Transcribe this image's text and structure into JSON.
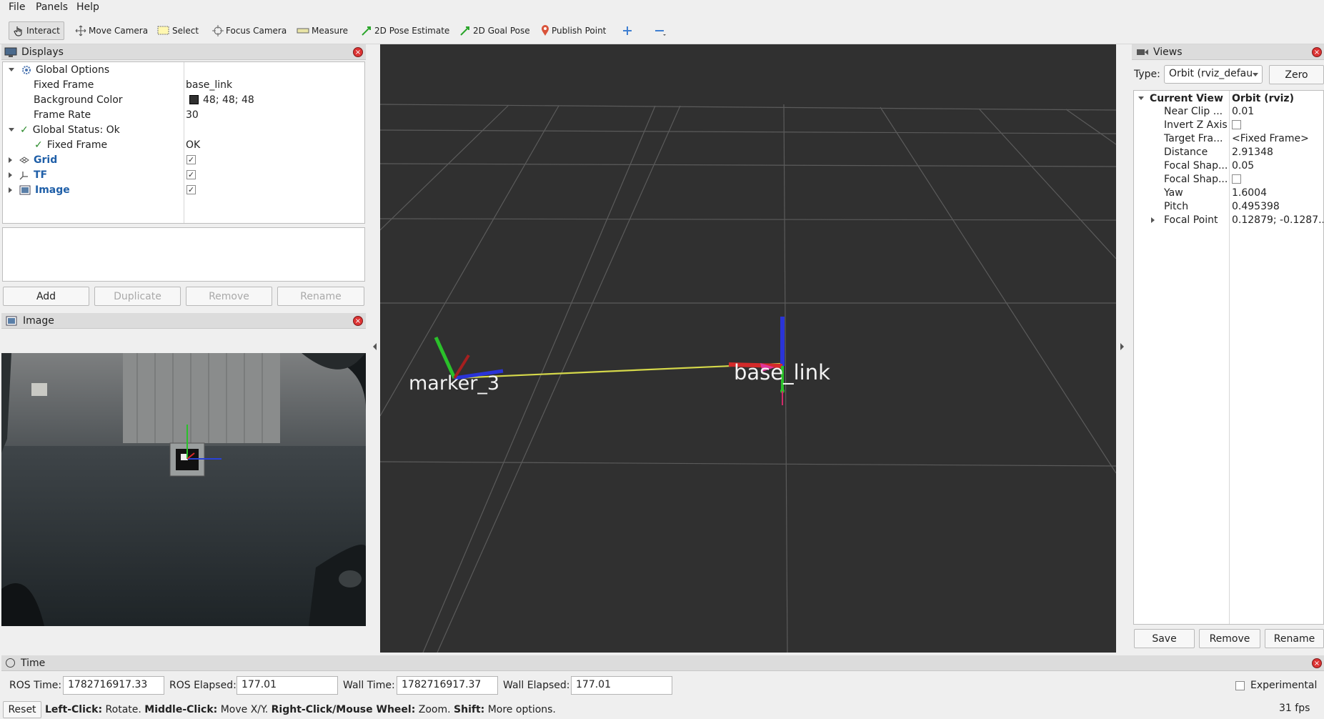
{
  "menu": [
    "File",
    "Panels",
    "Help"
  ],
  "toolbar": {
    "interact": "Interact",
    "move_camera": "Move Camera",
    "select": "Select",
    "focus_camera": "Focus Camera",
    "measure": "Measure",
    "pose_estimate": "2D Pose Estimate",
    "goal_pose": "2D Goal Pose",
    "publish_point": "Publish Point"
  },
  "displays": {
    "title": "Displays",
    "global_options": "Global Options",
    "fixed_frame_label": "Fixed Frame",
    "fixed_frame_value": "base_link",
    "bg_color_label": "Background Color",
    "bg_color_value": "48; 48; 48",
    "bg_color_hex": "#303030",
    "frame_rate_label": "Frame Rate",
    "frame_rate_value": "30",
    "global_status": "Global Status: Ok",
    "status_fixed_frame": "Fixed Frame",
    "status_fixed_frame_value": "OK",
    "items": [
      "Grid",
      "TF",
      "Image"
    ],
    "buttons": {
      "add": "Add",
      "duplicate": "Duplicate",
      "remove": "Remove",
      "rename": "Rename"
    }
  },
  "image_panel": {
    "title": "Image"
  },
  "viewport": {
    "labels": {
      "marker": "marker_3",
      "base": "base_link"
    },
    "bg_color": "#303030"
  },
  "views": {
    "title": "Views",
    "type_label": "Type:",
    "type_value": "Orbit (rviz_defau",
    "zero": "Zero",
    "current_view": "Current View",
    "current_view_value": "Orbit (rviz)",
    "props": [
      {
        "k": "Near Clip ...",
        "v": "0.01"
      },
      {
        "k": "Invert Z Axis",
        "v": ""
      },
      {
        "k": "Target Fra...",
        "v": "<Fixed Frame>"
      },
      {
        "k": "Distance",
        "v": "2.91348"
      },
      {
        "k": "Focal Shap...",
        "v": "0.05"
      },
      {
        "k": "Focal Shap...",
        "v": ""
      },
      {
        "k": "Yaw",
        "v": "1.6004"
      },
      {
        "k": "Pitch",
        "v": "0.495398"
      },
      {
        "k": "Focal Point",
        "v": "0.12879; -0.1287..."
      }
    ],
    "buttons": {
      "save": "Save",
      "remove": "Remove",
      "rename": "Rename"
    }
  },
  "time": {
    "title": "Time",
    "ros_time_label": "ROS Time:",
    "ros_time": "1782716917.33",
    "ros_elapsed_label": "ROS Elapsed:",
    "ros_elapsed": "177.01",
    "wall_time_label": "Wall Time:",
    "wall_time": "1782716917.37",
    "wall_elapsed_label": "Wall Elapsed:",
    "wall_elapsed": "177.01",
    "experimental": "Experimental"
  },
  "status": {
    "reset": "Reset",
    "k1": "Left-Click:",
    "v1": " Rotate. ",
    "k2": "Middle-Click:",
    "v2": " Move X/Y. ",
    "k3": "Right-Click/Mouse Wheel:",
    "v3": " Zoom. ",
    "k4": "Shift:",
    "v4": " More options.",
    "fps": "31 fps"
  }
}
